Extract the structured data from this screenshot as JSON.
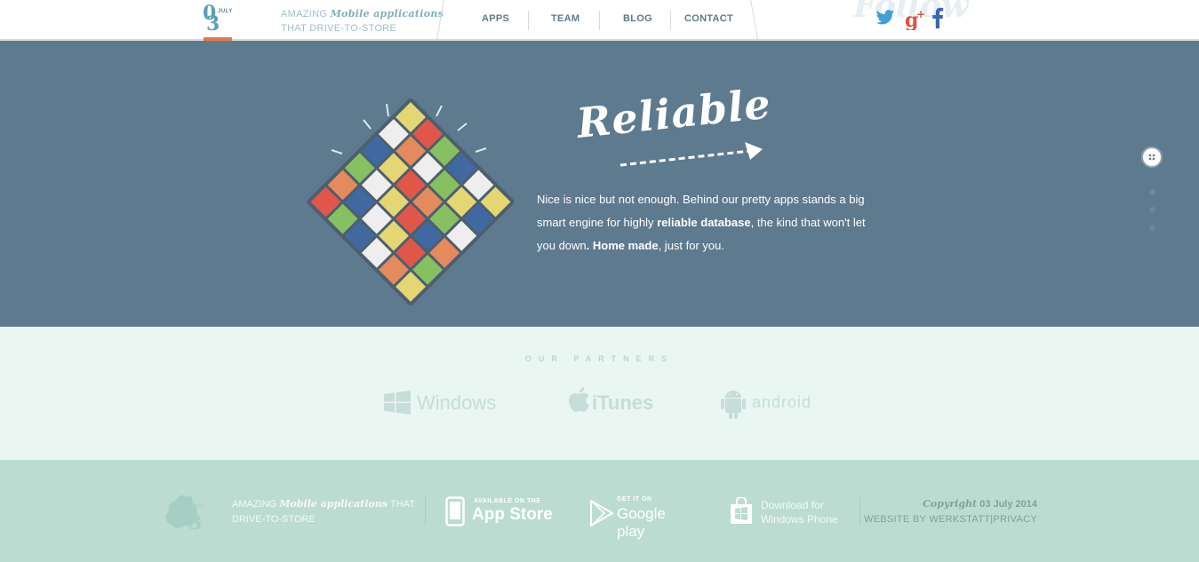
{
  "header": {
    "logo": {
      "digits_top": "0",
      "digits_bottom": "3",
      "month": "JULY"
    },
    "tagline": {
      "prefix": "AMAZING",
      "script": "Mobile applications",
      "line2": "THAT DRIVE-TO-STORE"
    },
    "nav": [
      {
        "label": "APPS"
      },
      {
        "label": "TEAM"
      },
      {
        "label": "BLOG"
      },
      {
        "label": "CONTACT"
      }
    ],
    "social": [
      {
        "icon": "twitter-icon",
        "color": "#3f9fd9"
      },
      {
        "icon": "google-plus-icon",
        "color": "#e0503e"
      },
      {
        "icon": "facebook-icon",
        "color": "#3c66b0"
      }
    ]
  },
  "hero": {
    "title": "Reliable",
    "text": {
      "part1": "Nice is nice but not enough. Behind our pretty apps stands a big smart engine for highly ",
      "bold1": "reliable database",
      "part2": ", the kind that won't let you down",
      "bold2": ". Home made",
      "part3": ", just for you."
    },
    "background_color": "#5e7a8e"
  },
  "partners": {
    "title": "OUR PARTNERS",
    "items": [
      {
        "name": "Windows",
        "icon": "windows-icon"
      },
      {
        "name": "iTunes",
        "icon": "apple-icon"
      },
      {
        "name": "android",
        "icon": "android-icon"
      }
    ]
  },
  "footer": {
    "tagline": {
      "prefix": "AMAZING",
      "script": "Mobile applications",
      "suffix": "THAT",
      "line2": "DRIVE-TO-STORE"
    },
    "stores": [
      {
        "small": "AVAILABLE ON THE",
        "big": "App Store",
        "icon": "phone-icon"
      },
      {
        "small": "GET IT ON",
        "big": "Google play",
        "icon": "google-play-icon"
      },
      {
        "small": "Download for",
        "big": "Windows Phone",
        "icon": "windows-store-icon"
      }
    ],
    "copyright": {
      "script": "Copyright",
      "date": "03 July 2014"
    },
    "credit": "WEBSITE BY WERKSTATT",
    "separator": "|",
    "privacy": "PRIVACY"
  }
}
